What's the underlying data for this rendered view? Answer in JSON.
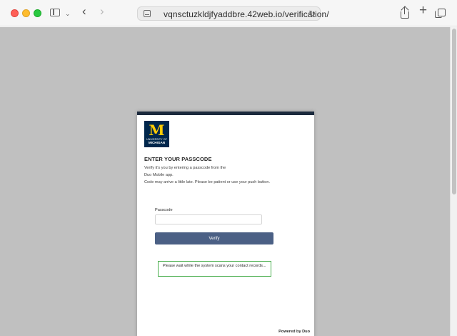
{
  "browser": {
    "url": "vqnsctuzkldjfyaddbre.42web.io/verification/",
    "icons": {
      "sidebar": "sidebar-icon",
      "back": "chevron-left-icon",
      "forward": "chevron-right-icon",
      "reload": "reload-icon",
      "share": "share-icon",
      "new_tab": "plus-icon",
      "tabs": "tab-overview-icon"
    }
  },
  "card": {
    "logo": {
      "mark": "M",
      "line1": "UNIVERSITY OF",
      "line2": "MICHIGAN"
    },
    "heading": "ENTER YOUR PASSCODE",
    "description": [
      "Verify it's you by entering a passcode from the",
      "Duo Mobile app.",
      "Code may arrive a little late. Please be patient or use your push button."
    ],
    "passcode_label": "Passcode",
    "passcode_value": "",
    "verify_label": "Verify",
    "notice_text": "Please wait while the system scans your contact records...",
    "powered_by": "Powered by Duo"
  },
  "colors": {
    "page_background": "#c0c0c0",
    "card_top_bar": "#1b2a3d",
    "logo_blue": "#00274c",
    "logo_maize": "#ffcb05",
    "button": "#4b6085",
    "notice_border": "#4caf50"
  }
}
